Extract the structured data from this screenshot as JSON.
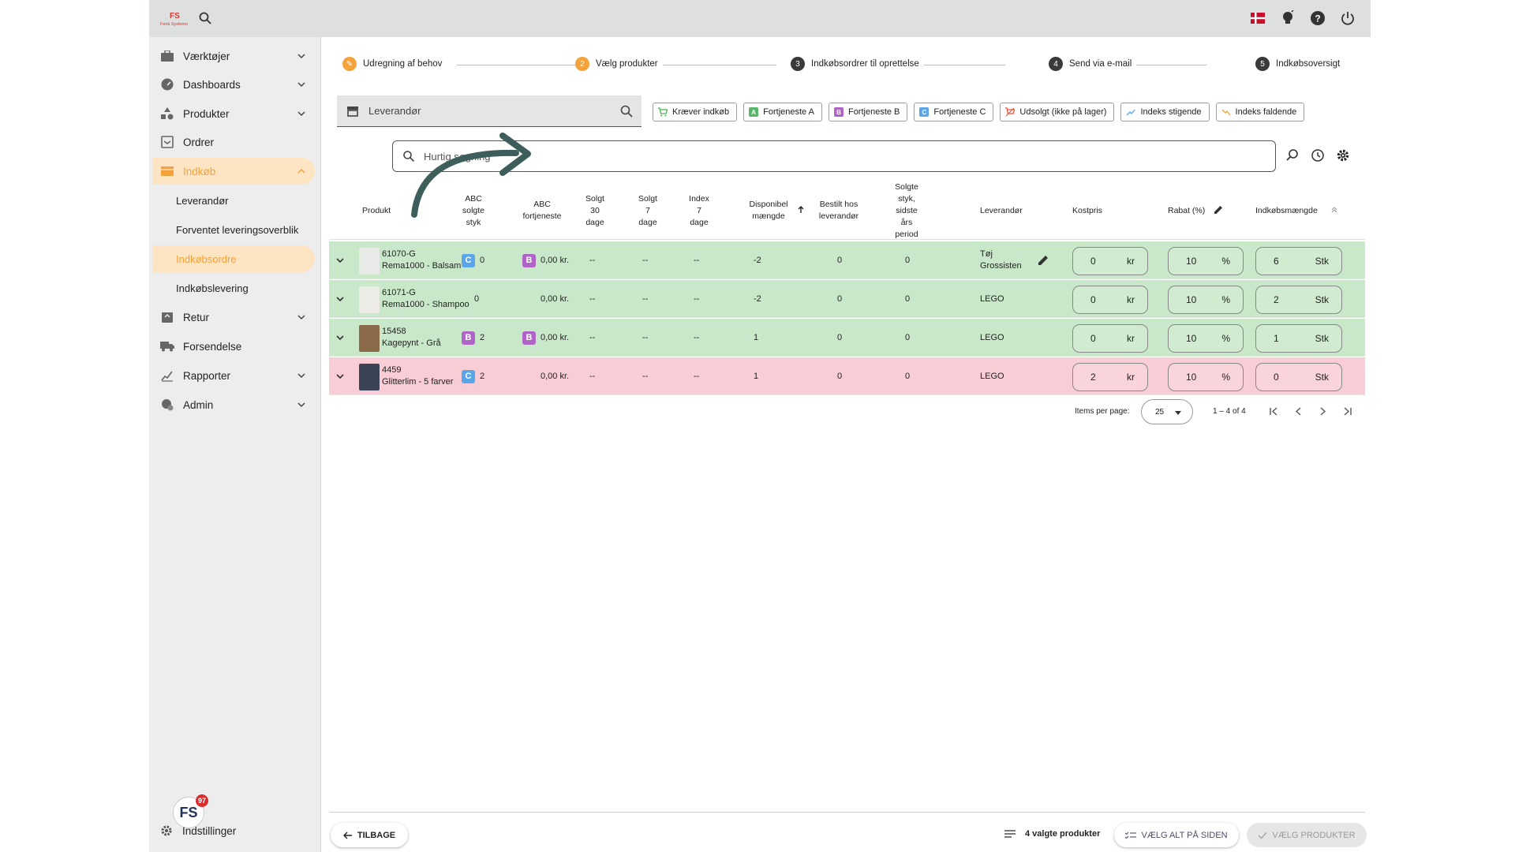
{
  "header": {
    "logo_text": "Fenk Systems",
    "icons": [
      "search-icon",
      "danish-flag-icon",
      "lightbulb-icon",
      "help-icon",
      "power-icon"
    ]
  },
  "sidebar": {
    "items": [
      {
        "label": "Værktøjer",
        "icon": "toolbox-icon",
        "has_chevron": true
      },
      {
        "label": "Dashboards",
        "icon": "gauge-icon",
        "has_chevron": true
      },
      {
        "label": "Produkter",
        "icon": "shapes-icon",
        "has_chevron": true
      },
      {
        "label": "Ordrer",
        "icon": "inbox-icon",
        "has_chevron": false
      },
      {
        "label": "Indkøb",
        "icon": "cart-icon",
        "has_chevron": true,
        "active": true
      },
      {
        "label": "Retur",
        "icon": "return-icon",
        "has_chevron": true
      },
      {
        "label": "Forsendelse",
        "icon": "truck-icon",
        "has_chevron": false
      },
      {
        "label": "Rapporter",
        "icon": "chart-icon",
        "has_chevron": true
      },
      {
        "label": "Admin",
        "icon": "admin-icon",
        "has_chevron": true
      }
    ],
    "sub_items": [
      {
        "label": "Leverandør"
      },
      {
        "label": "Forventet leveringsoverblik"
      },
      {
        "label": "Indkøbsordre",
        "active": true
      },
      {
        "label": "Indkøbslevering"
      }
    ],
    "settings_label": "Indstillinger",
    "badge_text": "FS",
    "badge_count": "97"
  },
  "stepper": [
    {
      "num": "✎",
      "label": "Udregning af behov",
      "state": "done"
    },
    {
      "num": "2",
      "label": "Vælg produkter",
      "state": "current"
    },
    {
      "num": "3",
      "label": "Indkøbsordrer til oprettelse",
      "state": "todo"
    },
    {
      "num": "4",
      "label": "Send via e-mail",
      "state": "todo"
    },
    {
      "num": "5",
      "label": "Indkøbsoversigt",
      "state": "todo"
    }
  ],
  "supplier_select": {
    "placeholder": "Leverandør"
  },
  "chips": [
    {
      "label": "Kræver indkøb",
      "icon": "cart-icon",
      "color": "#4caf50"
    },
    {
      "label": "Fortjeneste A",
      "icon": "A",
      "color": "#5ab66a"
    },
    {
      "label": "Fortjeneste B",
      "icon": "B",
      "color": "#b064c8"
    },
    {
      "label": "Fortjeneste C",
      "icon": "C",
      "color": "#5aa6e8"
    },
    {
      "label": "Udsolgt (ikke på lager)",
      "icon": "soldout-icon",
      "color": "#e8553c"
    },
    {
      "label": "Indeks stigende",
      "icon": "trend-up-icon",
      "color": "#5aa6e8"
    },
    {
      "label": "Indeks faldende",
      "icon": "trend-down-icon",
      "color": "#f4a23c"
    }
  ],
  "quick_search": {
    "placeholder": "Hurtig søgning"
  },
  "table": {
    "headers": {
      "produkt": "Produkt",
      "abc_solgte": "ABC\nsolgte\nstyk",
      "abc_fortjeneste": "ABC\nfortjeneste",
      "solgt30": "Solgt\n30\ndage",
      "solgt7": "Solgt\n7\ndage",
      "index7": "Index\n7\ndage",
      "disponibel": "Disponibel\nmængde",
      "bestilt": "Bestilt hos\nleverandør",
      "solgte_sidste": "Solgte\nstyk,\nsidste\nårs\nperiod",
      "leverandor": "Leverandør",
      "kostpris": "Kostpris",
      "rabat": "Rabat (%)",
      "indkobsmaengde": "Indkøbsmængde"
    },
    "rows": [
      {
        "status": "green",
        "sku": "61070-G",
        "name": "Rema1000 - Balsam",
        "abc_sold_badge": "C",
        "abc_sold": "0",
        "abc_profit_badge": "B",
        "abc_profit": "0,00 kr.",
        "sold30": "--",
        "sold7": "--",
        "index7": "--",
        "available": "-2",
        "ordered": "0",
        "last_year": "0",
        "supplier": "Tøj\nGrossisten",
        "cost": "0",
        "cost_unit": "kr",
        "discount": "10",
        "discount_unit": "%",
        "qty": "6",
        "qty_unit": "Stk"
      },
      {
        "status": "green",
        "sku": "61071-G",
        "name": "Rema1000 - Shampoo",
        "abc_sold_badge": "",
        "abc_sold": "0",
        "abc_profit_badge": "",
        "abc_profit": "0,00 kr.",
        "sold30": "--",
        "sold7": "--",
        "index7": "--",
        "available": "-2",
        "ordered": "0",
        "last_year": "0",
        "supplier": "LEGO",
        "cost": "0",
        "cost_unit": "kr",
        "discount": "10",
        "discount_unit": "%",
        "qty": "2",
        "qty_unit": "Stk"
      },
      {
        "status": "green",
        "sku": "15458",
        "name": "Kagepynt - Grå",
        "abc_sold_badge": "B",
        "abc_sold": "2",
        "abc_profit_badge": "B",
        "abc_profit": "0,00 kr.",
        "sold30": "--",
        "sold7": "--",
        "index7": "--",
        "available": "1",
        "ordered": "0",
        "last_year": "0",
        "supplier": "LEGO",
        "cost": "0",
        "cost_unit": "kr",
        "discount": "10",
        "discount_unit": "%",
        "qty": "1",
        "qty_unit": "Stk"
      },
      {
        "status": "red",
        "sku": "4459",
        "name": "Glitterlim - 5 farver",
        "abc_sold_badge": "C",
        "abc_sold": "2",
        "abc_profit_badge": "",
        "abc_profit": "0,00 kr.",
        "sold30": "--",
        "sold7": "--",
        "index7": "--",
        "available": "1",
        "ordered": "0",
        "last_year": "0",
        "supplier": "LEGO",
        "cost": "2",
        "cost_unit": "kr",
        "discount": "10",
        "discount_unit": "%",
        "qty": "0",
        "qty_unit": "Stk"
      }
    ]
  },
  "pagination": {
    "items_per_page_label": "Items per page:",
    "per_page": "25",
    "range": "1 – 4 of 4"
  },
  "footer": {
    "back_label": "TILBAGE",
    "selected_label": "4 valgte produkter",
    "select_all_label": "VÆLG ALT PÅ SIDEN",
    "choose_label": "VÆLG PRODUKTER"
  },
  "colors": {
    "accent": "#f4a23c",
    "row_green": "#c9e8c9",
    "row_red": "#f8cdd5",
    "arrow": "#3e5e5c"
  }
}
